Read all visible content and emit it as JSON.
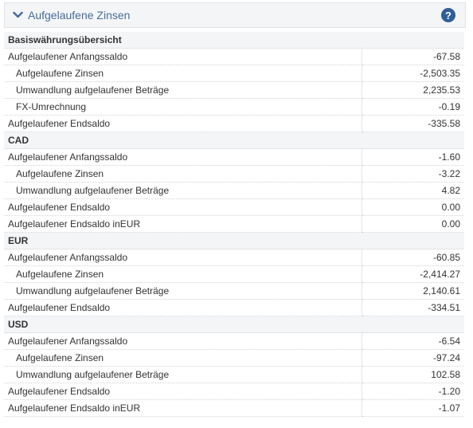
{
  "header": {
    "title": "Aufgelaufene Zinsen",
    "help_glyph": "?"
  },
  "sections": [
    {
      "title": "Basiswährungsübersicht",
      "rows": [
        {
          "label": "Aufgelaufener Anfangssaldo",
          "value": "-67.58"
        },
        {
          "label": "Aufgelaufene Zinsen",
          "value": "-2,503.35"
        },
        {
          "label": "Umwandlung aufgelaufener Beträge",
          "value": "2,235.53"
        },
        {
          "label": "FX-Umrechnung",
          "value": "-0.19"
        },
        {
          "label": "Aufgelaufener Endsaldo",
          "value": "-335.58"
        }
      ]
    },
    {
      "title": "CAD",
      "rows": [
        {
          "label": "Aufgelaufener Anfangssaldo",
          "value": "-1.60"
        },
        {
          "label": "Aufgelaufene Zinsen",
          "value": "-3.22"
        },
        {
          "label": "Umwandlung aufgelaufener Beträge",
          "value": "4.82"
        },
        {
          "label": "Aufgelaufener Endsaldo",
          "value": "0.00"
        },
        {
          "label": "Aufgelaufener Endsaldo inEUR",
          "value": "0.00"
        }
      ]
    },
    {
      "title": "EUR",
      "rows": [
        {
          "label": "Aufgelaufener Anfangssaldo",
          "value": "-60.85"
        },
        {
          "label": "Aufgelaufene Zinsen",
          "value": "-2,414.27"
        },
        {
          "label": "Umwandlung aufgelaufener Beträge",
          "value": "2,140.61"
        },
        {
          "label": "Aufgelaufener Endsaldo",
          "value": "-334.51"
        }
      ]
    },
    {
      "title": "USD",
      "rows": [
        {
          "label": "Aufgelaufener Anfangssaldo",
          "value": "-6.54"
        },
        {
          "label": "Aufgelaufene Zinsen",
          "value": "-97.24"
        },
        {
          "label": "Umwandlung aufgelaufener Beträge",
          "value": "102.58"
        },
        {
          "label": "Aufgelaufener Endsaldo",
          "value": "-1.20"
        },
        {
          "label": "Aufgelaufener Endsaldo inEUR",
          "value": "-1.07"
        }
      ]
    }
  ]
}
